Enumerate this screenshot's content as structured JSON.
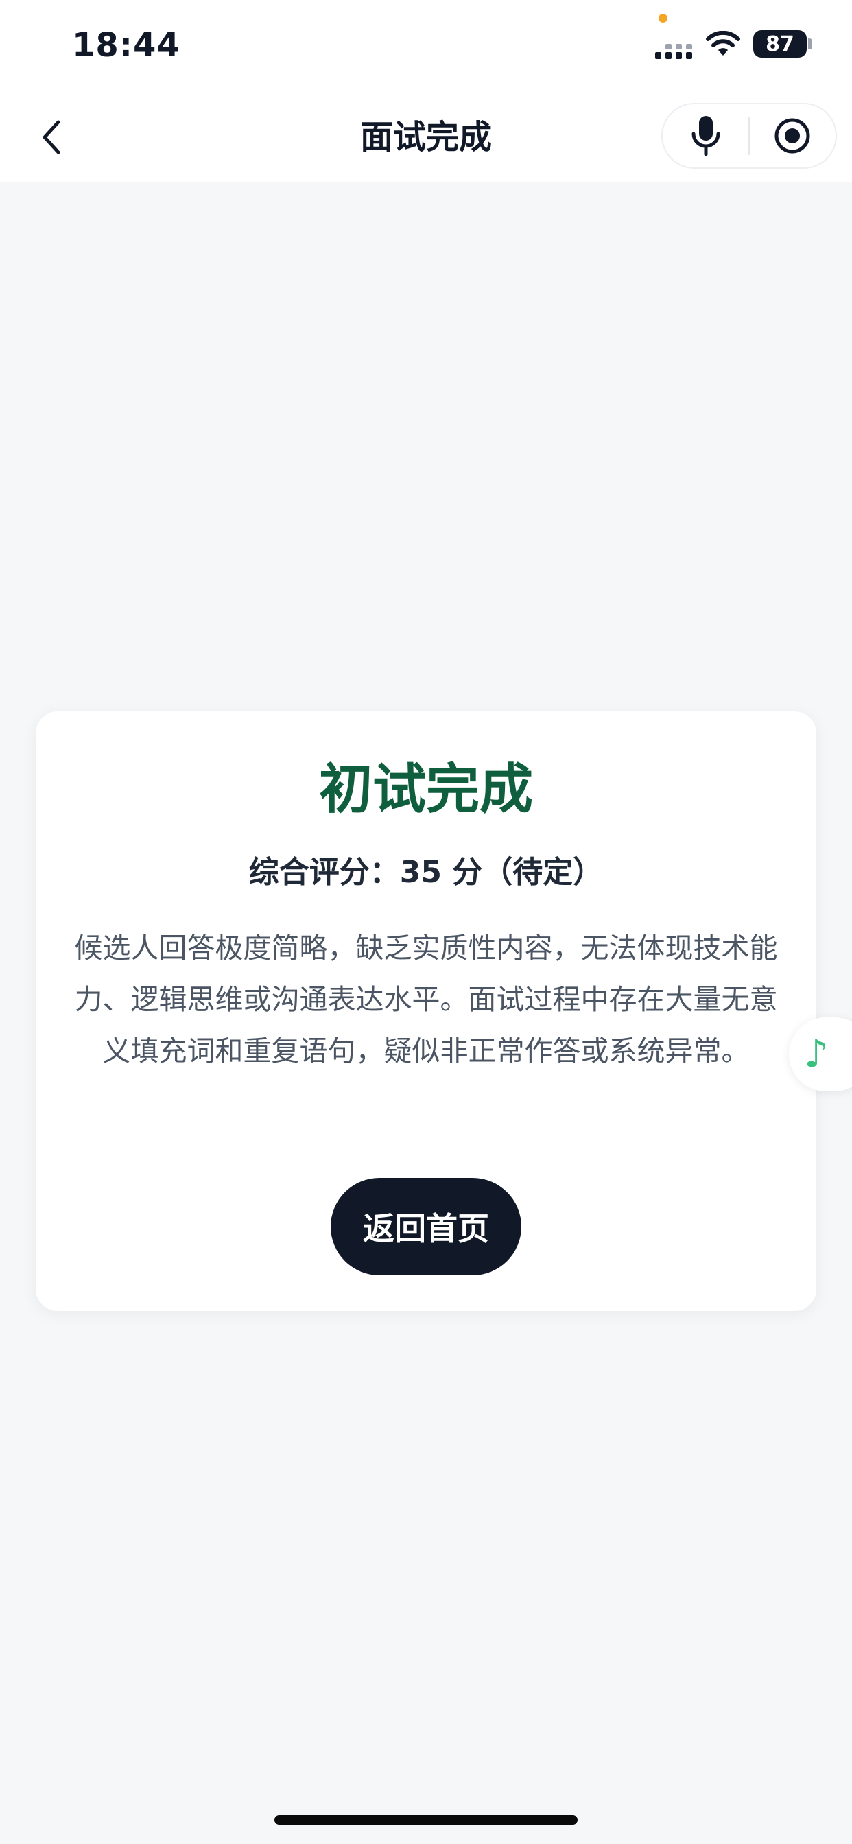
{
  "status_bar": {
    "time": "18:44",
    "battery": "87"
  },
  "nav": {
    "title": "面试完成",
    "icons": [
      "chevron-left-icon",
      "microphone-icon",
      "record-target-icon"
    ]
  },
  "result": {
    "title": "初试完成",
    "score_line": "综合评分：35 分（待定）",
    "summary": "候选人回答极度简略，缺乏实质性内容，无法体现技术能力、逻辑思维或沟通表达水平。面试过程中存在大量无意义填充词和重复语句，疑似非正常作答或系统异常。",
    "home_button": "返回首页"
  },
  "floating": {
    "music_icon": "♪"
  },
  "colors": {
    "accent_green": "#0f5e3d",
    "button_dark": "#111827",
    "background": "#f6f7f9",
    "music_green": "#39c07f",
    "privacy_dot": "#f5a524"
  }
}
